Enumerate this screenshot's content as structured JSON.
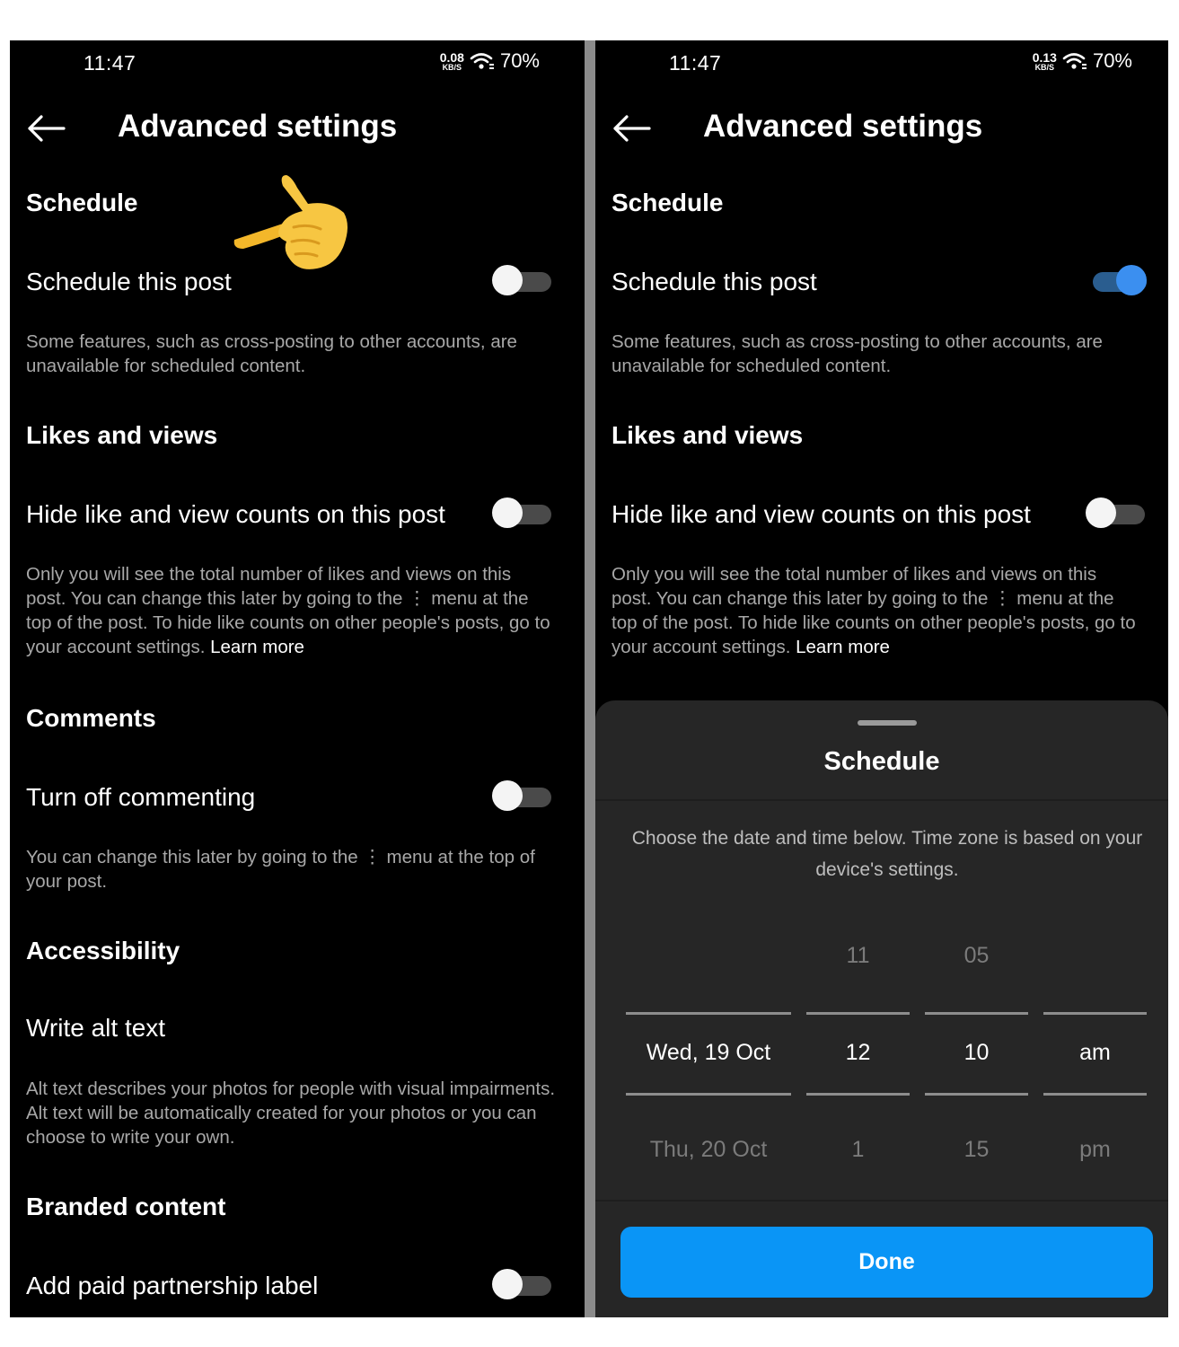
{
  "status": {
    "time": "11:47",
    "battery": "70%",
    "net_unit": "KB/S"
  },
  "left": {
    "net_speed": "0.08",
    "title": "Advanced settings",
    "sections": {
      "schedule": "Schedule",
      "likes": "Likes and views",
      "comments": "Comments",
      "accessibility": "Accessibility",
      "branded": "Branded content"
    },
    "rows": {
      "schedule_post": "Schedule this post",
      "hide_likes": "Hide like and view counts on this post",
      "turn_off_comments": "Turn off commenting",
      "alt_text": "Write alt text",
      "paid_label": "Add paid partnership label"
    },
    "descs": {
      "schedule": "Some features, such as cross-posting to other accounts, are unavailable for scheduled content.",
      "likes": "Only you will see the total number of likes and views on this post. You can change this later by going to the ⋮ menu at the top of the post. To hide like counts on other people's posts, go to your account settings.",
      "learn_more": "Learn more",
      "comments": "You can change this later by going to the ⋮ menu at the top of your post.",
      "alt_text": "Alt text describes your photos for people with visual impairments. Alt text will be automatically created for your photos or you can choose to write your own."
    },
    "toggles": {
      "schedule_post": false,
      "hide_likes": false,
      "turn_off_comments": false,
      "paid_label": false
    }
  },
  "right": {
    "net_speed": "0.13",
    "title": "Advanced settings",
    "sections": {
      "schedule": "Schedule",
      "likes": "Likes and views"
    },
    "rows": {
      "schedule_post": "Schedule this post",
      "hide_likes": "Hide like and view counts on this post"
    },
    "descs": {
      "schedule": "Some features, such as cross-posting to other accounts, are unavailable for scheduled content.",
      "likes": "Only you will see the total number of likes and views on this post. You can change this later by going to the ⋮ menu at the top of the post. To hide like counts on other people's posts, go to your account settings.",
      "learn_more": "Learn more"
    },
    "toggles": {
      "schedule_post": true,
      "hide_likes": false
    },
    "sheet": {
      "title": "Schedule",
      "description": "Choose the date and time below. Time zone is based on your device's settings.",
      "picker": {
        "date": {
          "prev": "",
          "selected": "Wed, 19 Oct",
          "next": "Thu, 20 Oct"
        },
        "hour": {
          "prev": "11",
          "selected": "12",
          "next": "1"
        },
        "minute": {
          "prev": "05",
          "selected": "10",
          "next": "15"
        },
        "ampm": {
          "prev": "",
          "selected": "am",
          "next": "pm"
        }
      },
      "done": "Done"
    }
  },
  "colors": {
    "toggle_on": "#3b8ff0",
    "done_button": "#0a95f6",
    "sheet_bg": "#262626"
  },
  "icons": [
    "back-arrow-icon",
    "wifi-icon",
    "pointing-hand-emoji"
  ]
}
